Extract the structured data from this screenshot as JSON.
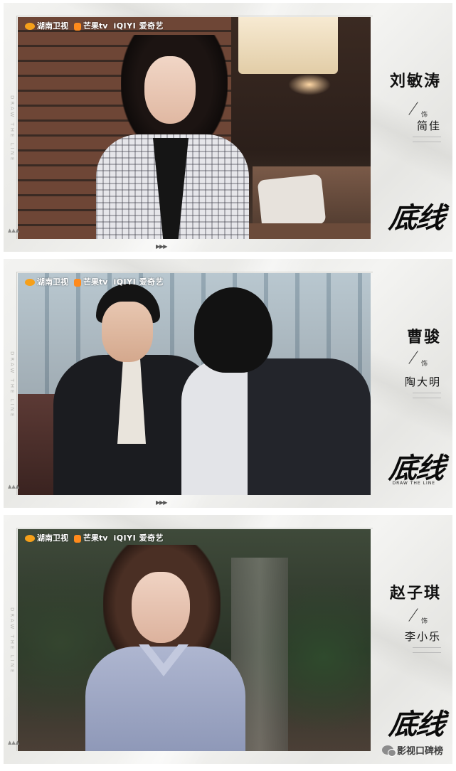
{
  "logos": {
    "hunan": "湖南卫视",
    "mango": "芒果tv",
    "iqiyi": "iQIYI",
    "iqiyi_cn": "爱奇艺"
  },
  "cards": [
    {
      "actor": "刘敏涛",
      "as": "饰",
      "role": "简佳"
    },
    {
      "actor": "曹骏",
      "as": "饰",
      "role": "陶大明"
    },
    {
      "actor": "赵子琪",
      "as": "饰",
      "role": "李小乐"
    }
  ],
  "show": {
    "title": "底线",
    "subtitle": "DRAW THE LINE"
  },
  "arrows": "▶▶▶",
  "watermark": "影视口碑榜"
}
